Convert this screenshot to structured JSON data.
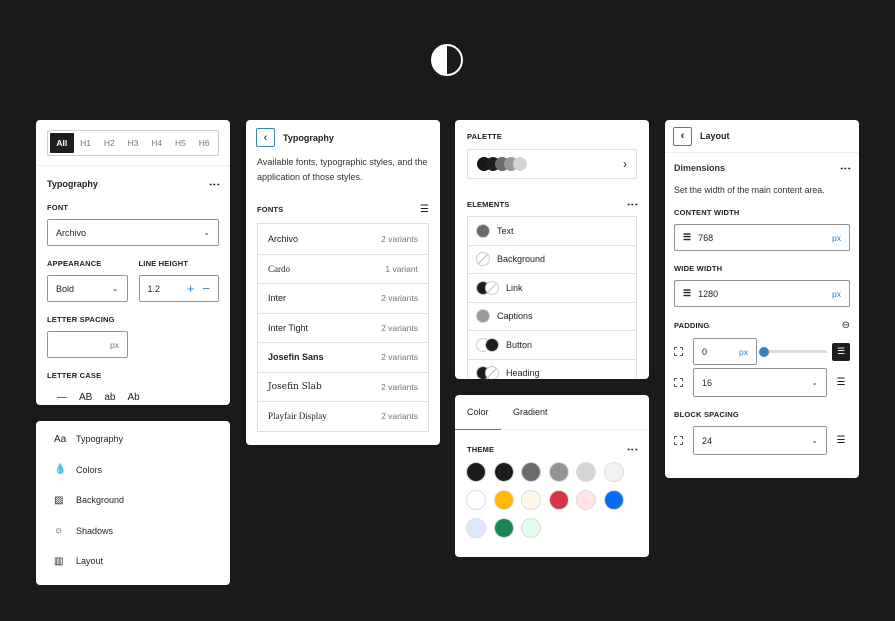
{
  "logo": "half-circle-logo",
  "typography_panel": {
    "levels": [
      "All",
      "H1",
      "H2",
      "H3",
      "H4",
      "H5",
      "H6"
    ],
    "title": "Typography",
    "font_label": "Font",
    "font_value": "Archivo",
    "appearance_label": "Appearance",
    "appearance_value": "Bold",
    "line_height_label": "Line height",
    "line_height_value": "1.2",
    "letter_spacing_label": "Letter spacing",
    "letter_spacing_unit": "px",
    "letter_case_label": "Letter case",
    "letter_case_options": [
      "—",
      "AB",
      "ab",
      "Ab"
    ]
  },
  "nav": {
    "items": [
      {
        "icon": "Aa",
        "label": "Typography"
      },
      {
        "icon": "💧",
        "label": "Colors"
      },
      {
        "icon": "▨",
        "label": "Background"
      },
      {
        "icon": "☼",
        "label": "Shadows"
      },
      {
        "icon": "▥",
        "label": "Layout"
      }
    ]
  },
  "fonts_panel": {
    "title": "Typography",
    "description": "Available fonts, typographic styles, and the application of those styles.",
    "fonts_label": "Fonts",
    "fonts": [
      {
        "name": "Archivo",
        "variants": "2 variants"
      },
      {
        "name": "Cardo",
        "variants": "1 variant"
      },
      {
        "name": "Inter",
        "variants": "2 variants"
      },
      {
        "name": "Inter Tight",
        "variants": "2 variants"
      },
      {
        "name": "Josefin Sans",
        "variants": "2 variants"
      },
      {
        "name": "Josefin Slab",
        "variants": "2 variants"
      },
      {
        "name": "Playfair Display",
        "variants": "2 variants"
      }
    ]
  },
  "palette_panel": {
    "palette_label": "Palette",
    "palette_colors": [
      "#1a1a1a",
      "#1e1e1e",
      "#6b6b6b",
      "#9a9a9a",
      "#d4d4d4"
    ],
    "elements_label": "Elements",
    "elements": [
      "Text",
      "Background",
      "Link",
      "Captions",
      "Button",
      "Heading"
    ]
  },
  "color_panel": {
    "tabs": [
      "Color",
      "Gradient"
    ],
    "theme_label": "Theme",
    "swatches": [
      "#1a1a1a",
      "#1e1e1e",
      "#6b6b6b",
      "#949494",
      "#d4d4d4",
      "#f2f2f2",
      "#ffffff",
      "#ffb900",
      "#fff8ea",
      "#d63644",
      "#ffe2e4",
      "#0a6cf5",
      "#dbe8fe",
      "#1b8553",
      "#e2fcec"
    ]
  },
  "layout_panel": {
    "title": "Layout",
    "section": "Dimensions",
    "description": "Set the width of the main content area.",
    "content_width_label": "Content width",
    "content_width": "768",
    "wide_width_label": "Wide width",
    "wide_width": "1280",
    "unit": "px",
    "padding_label": "Padding",
    "padding_value": "0",
    "padding_slider": 0,
    "padding_horizontal": "16",
    "block_spacing_label": "Block spacing",
    "block_spacing": "24"
  },
  "accent": "#3582c4"
}
